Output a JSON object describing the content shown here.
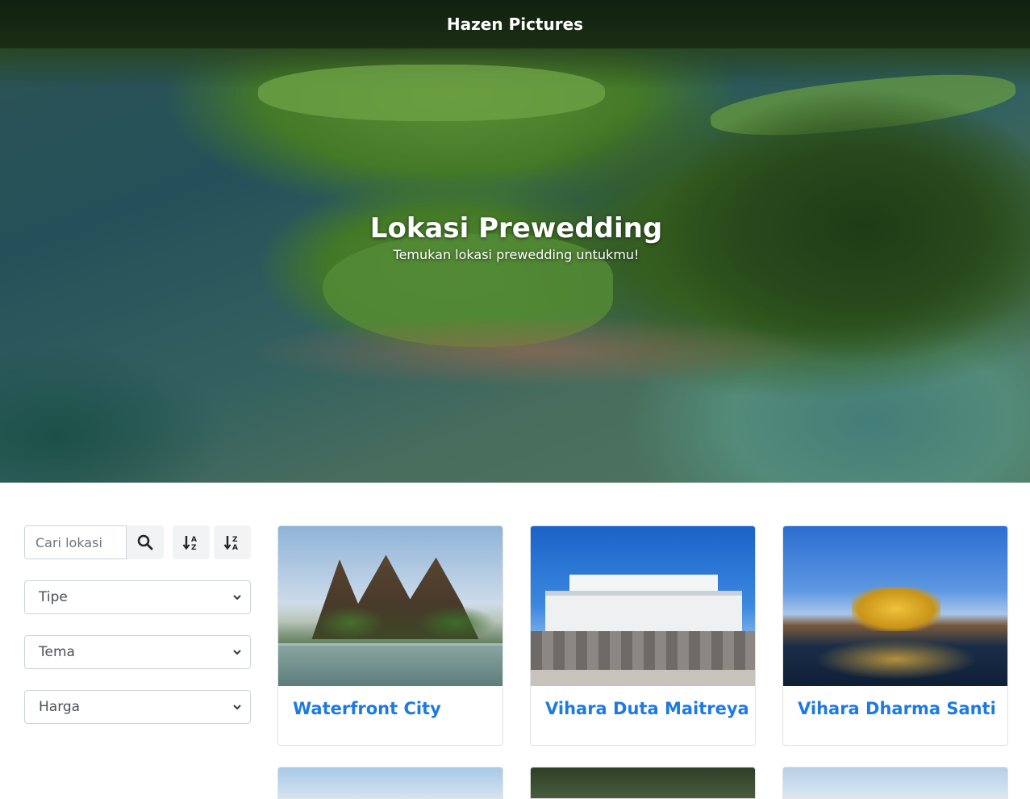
{
  "navbar": {
    "brand": "Hazen Pictures"
  },
  "hero": {
    "title": "Lokasi Prewedding",
    "subtitle": "Temukan lokasi prewedding untukmu!"
  },
  "filters": {
    "search_placeholder": "Cari lokasi",
    "search_icon": "search-icon",
    "sort_asc_icon": "sort-alpha-down-icon",
    "sort_desc_icon": "sort-alpha-up-icon",
    "selects": [
      {
        "label": "Tipe"
      },
      {
        "label": "Tema"
      },
      {
        "label": "Harga"
      }
    ]
  },
  "cards": [
    {
      "title": "Waterfront City"
    },
    {
      "title": "Vihara Duta Maitreya"
    },
    {
      "title": "Vihara Dharma Santi"
    }
  ],
  "colors": {
    "link": "#1f7ae0",
    "button_bg": "#f1f3f5",
    "border": "#dee2e6"
  }
}
